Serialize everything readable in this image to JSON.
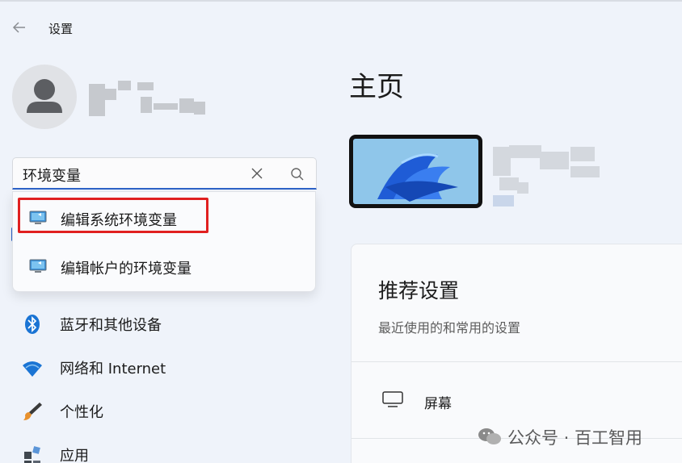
{
  "window": {
    "title": "设置"
  },
  "search": {
    "value": "环境变量"
  },
  "search_results": [
    {
      "label": "编辑系统环境变量",
      "icon": "system-properties-icon"
    },
    {
      "label": "编辑帐户的环境变量",
      "icon": "system-properties-icon"
    }
  ],
  "sidebar": {
    "items": [
      {
        "label": "蓝牙和其他设备",
        "icon": "bluetooth-icon"
      },
      {
        "label": "网络和 Internet",
        "icon": "wifi-icon"
      },
      {
        "label": "个性化",
        "icon": "brush-icon"
      },
      {
        "label": "应用",
        "icon": "apps-icon"
      }
    ]
  },
  "main": {
    "title": "主页",
    "recommended": {
      "title": "推荐设置",
      "subtitle": "最近使用的和常用的设置",
      "items": [
        {
          "label": "屏幕",
          "icon": "display-icon"
        }
      ]
    }
  },
  "watermark": {
    "text": "公众号 · 百工智用"
  },
  "colors": {
    "accent": "#2d63c8",
    "highlight": "#e02020",
    "background": "#eff3fa"
  }
}
